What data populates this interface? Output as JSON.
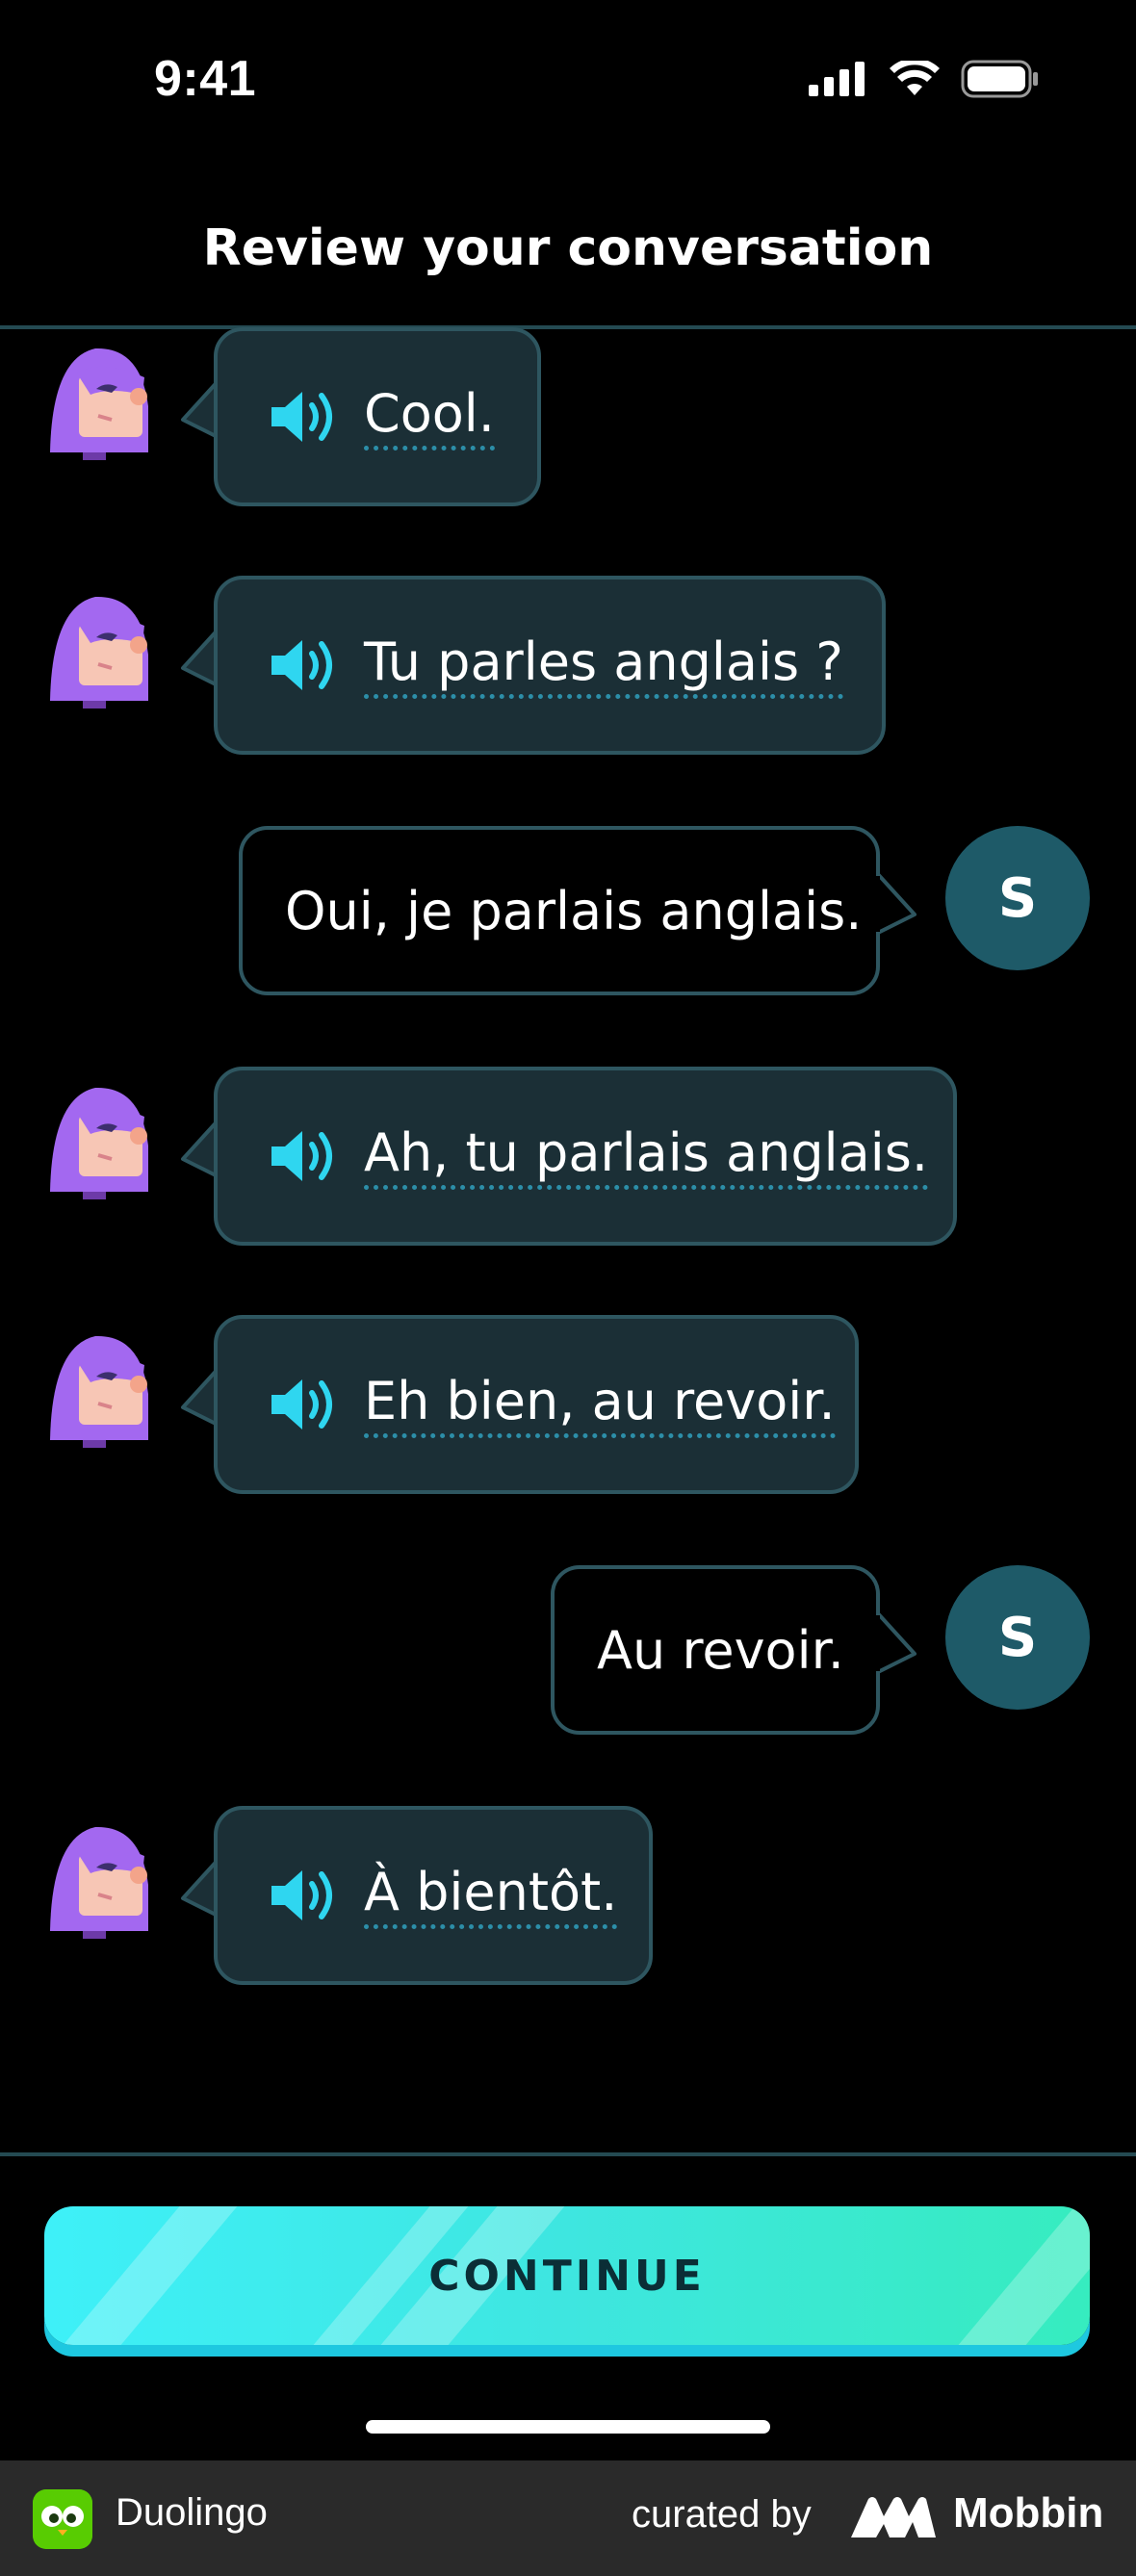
{
  "status_bar": {
    "time": "9:41"
  },
  "header": {
    "title": "Review your conversation"
  },
  "messages": [
    {
      "speaker": "bot",
      "text": "Cool."
    },
    {
      "speaker": "bot",
      "text": "Tu parles anglais ?"
    },
    {
      "speaker": "user",
      "avatar_letter": "S",
      "text": "Oui, je parlais anglais."
    },
    {
      "speaker": "bot",
      "text": "Ah, tu parlais anglais."
    },
    {
      "speaker": "bot",
      "text": "Eh bien, au revoir."
    },
    {
      "speaker": "user",
      "avatar_letter": "S",
      "text": "Au revoir."
    },
    {
      "speaker": "bot",
      "text": "À bientôt."
    }
  ],
  "continue_button": {
    "label": "CONTINUE"
  },
  "footer": {
    "app_name": "Duolingo",
    "curated_by": "curated by",
    "brand": "Mobbin"
  },
  "icons": [
    "signal-icon",
    "wifi-icon",
    "battery-icon",
    "speaker-icon",
    "character-avatar-icon",
    "duolingo-logo-icon",
    "mobbin-logo-icon"
  ],
  "colors": {
    "background": "#000000",
    "bot_bubble": "#1b2f36",
    "bubble_border": "#2e5660",
    "accent_cyan": "#3ee6e0",
    "user_avatar": "#1e5a68",
    "character_hair": "#a368f0"
  }
}
